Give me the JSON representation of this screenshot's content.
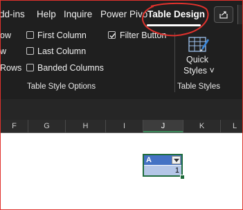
{
  "ribbon": {
    "tabs": [
      {
        "label": "dd-ins"
      },
      {
        "label": "Help"
      },
      {
        "label": "Inquire"
      },
      {
        "label": "Power Pivo"
      },
      {
        "label": "Table Design",
        "active": true
      }
    ],
    "table_style_options": {
      "group_label": "Table Style Options",
      "left_column_partial": [
        "ow",
        "w",
        "Rows"
      ],
      "options": [
        {
          "label": "First Column",
          "checked": false
        },
        {
          "label": "Last Column",
          "checked": false
        },
        {
          "label": "Banded Columns",
          "checked": false
        },
        {
          "label": "Filter Button",
          "checked": true
        }
      ]
    },
    "table_styles": {
      "group_label": "Table Styles",
      "quick_styles_line1": "Quick",
      "quick_styles_line2": "Styles ˅"
    },
    "share_icon": "share-icon"
  },
  "annotation": {
    "color": "#e0322d"
  },
  "sheet": {
    "columns": [
      "F",
      "G",
      "H",
      "I",
      "J",
      "K",
      "L"
    ],
    "selected_column": "J",
    "table": {
      "header": "A",
      "value": "1",
      "header_color": "#4472c4",
      "row_color": "#b4c6e7"
    }
  }
}
